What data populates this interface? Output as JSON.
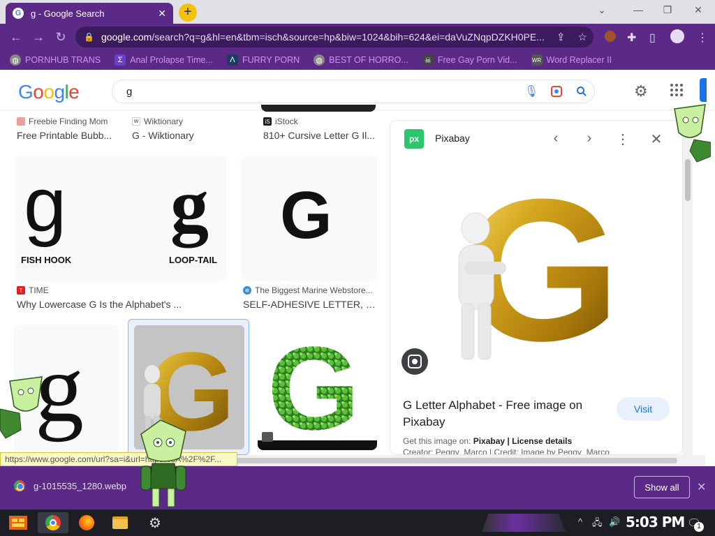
{
  "browser": {
    "tab_title": "g - Google Search",
    "tab_close": "✕",
    "new_tab": "+",
    "url_domain": "google.com",
    "url_rest": "/search?q=g&hl=en&tbm=isch&source=hp&biw=1024&bih=624&ei=daVuZNqpDZKH0PE...",
    "colors": {
      "theme": "#5b2a86",
      "bookmark_text": "#d88cf7"
    }
  },
  "bookmarks": [
    {
      "label": "PORNHUB TRANS",
      "icon": "globe-icon",
      "color": "#888"
    },
    {
      "label": "Anal Prolapse Time...",
      "icon": "sigma-icon",
      "color": "#6a3fd1"
    },
    {
      "label": "FURRY PORN",
      "icon": "lambda-icon",
      "color": "#1d3d5e"
    },
    {
      "label": "BEST OF HORRO...",
      "icon": "globe-icon",
      "color": "#888"
    },
    {
      "label": "Free Gay Porn Vid...",
      "icon": "skull-icon",
      "color": "#444"
    },
    {
      "label": "Word Replacer II",
      "icon": "wr-icon",
      "color": "#555"
    }
  ],
  "google": {
    "logo": "Google",
    "query": "g"
  },
  "results": {
    "row0": [
      {
        "source": "Freebie Finding Mom",
        "title": "Free Printable Bubb..."
      },
      {
        "source": "Wiktionary",
        "title": "G - Wiktionary"
      },
      {
        "source": "iStock",
        "title": "810+ Cursive Letter G Il..."
      }
    ],
    "fishhook": {
      "left_label": "FISH HOOK",
      "right_label": "LOOP-TAIL"
    },
    "row1": [
      {
        "source": "TIME",
        "title": "Why Lowercase G Is the Alphabet's ..."
      },
      {
        "source": "The Biggest Marine Webstore...",
        "title": "SELF-ADHESIVE LETTER, 20..."
      }
    ]
  },
  "preview": {
    "site": "Pixabay",
    "logo_text": "px",
    "title": "G Letter Alphabet - Free image on Pixabay",
    "visit": "Visit",
    "get_prefix": "Get this image on: ",
    "get_site": "Pixabay",
    "get_sep": " | ",
    "license": "License details",
    "credit": "Creator: Peggy_Marco | Credit: Image by Peggy_Marco"
  },
  "status_url": "https://www.google.com/url?sa=i&url=https%3A%2F%2F...",
  "download": {
    "filename": "g-1015535_1280.webp",
    "show_all": "Show all"
  },
  "taskbar": {
    "time": "5:03 PM",
    "notification_count": "1"
  }
}
